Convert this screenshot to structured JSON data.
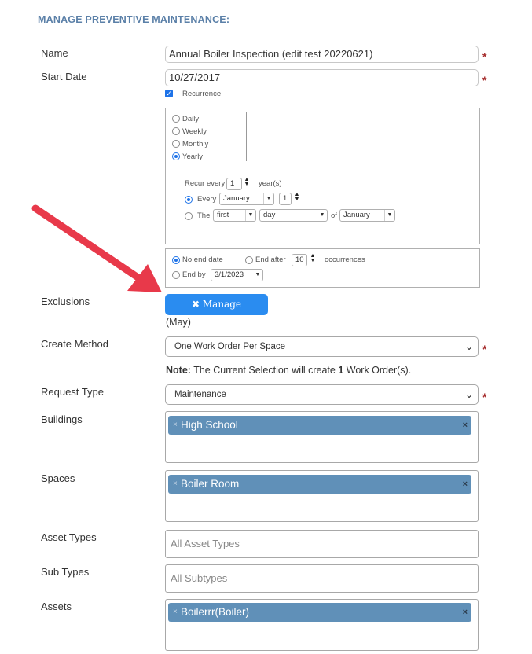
{
  "heading": "MANAGE PREVENTIVE MAINTENANCE:",
  "labels": {
    "name": "Name",
    "start_date": "Start Date",
    "exclusions": "Exclusions",
    "create_method": "Create Method",
    "request_type": "Request Type",
    "buildings": "Buildings",
    "spaces": "Spaces",
    "asset_types": "Asset Types",
    "sub_types": "Sub Types",
    "assets": "Assets"
  },
  "required_mark": "*",
  "name_value": "Annual Boiler Inspection (edit test 20220621)",
  "start_date_value": "10/27/2017",
  "recurrence": {
    "label": "Recurrence",
    "checked": true,
    "patterns": [
      "Daily",
      "Weekly",
      "Monthly",
      "Yearly"
    ],
    "selected_pattern": "Yearly",
    "recur_every_label": "Recur every",
    "recur_every_value": "1",
    "recur_unit": "year(s)",
    "every_label": "Every",
    "every_month": "January",
    "every_day": "1",
    "the_label": "The",
    "the_ordinal": "first",
    "the_day": "day",
    "of_label": "of",
    "the_month": "January"
  },
  "range": {
    "no_end_label": "No end date",
    "end_after_label": "End after",
    "end_after_value": "10",
    "occurrences_label": "occurrences",
    "end_by_label": "End by",
    "end_by_value": "3/1/2023"
  },
  "exclusions": {
    "button_icon": "✖",
    "button_label": "Manage Exclusions",
    "summary": "(May)"
  },
  "create_method_value": "One Work Order Per Space",
  "note": {
    "prefix": "Note:",
    "text_before": "The Current Selection will create",
    "count": "1",
    "text_after": "Work Order(s)."
  },
  "request_type_value": "Maintenance",
  "buildings_tags": [
    "High School"
  ],
  "spaces_tags": [
    "Boiler Room"
  ],
  "asset_types_placeholder": "All Asset Types",
  "sub_types_placeholder": "All Subtypes",
  "assets_tags": [
    "Boilerrr(Boiler)"
  ],
  "colors": {
    "heading": "#5b80a8",
    "accent_button": "#2a8cf0",
    "tag_bg": "#6090b8",
    "required": "#a52a2a",
    "arrow": "#e8394a"
  },
  "icons": {
    "tag_remove": "×",
    "dropdown": "chevron-down-icon",
    "annotation": "red-arrow"
  }
}
